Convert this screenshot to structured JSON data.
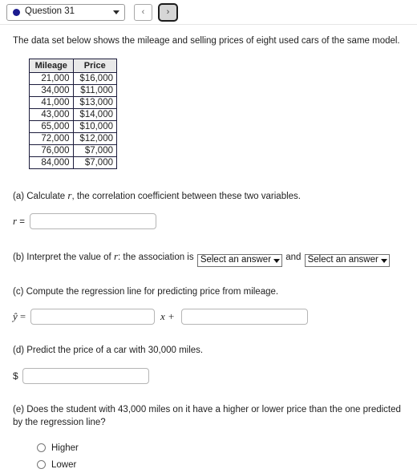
{
  "topbar": {
    "question_label": "Question 31",
    "dot_color": "#1b1b8f",
    "prev_label": "‹",
    "next_label": "›"
  },
  "intro": "The data set below shows the mileage and selling prices of eight used cars of the same model.",
  "table": {
    "headers": [
      "Mileage",
      "Price"
    ],
    "rows": [
      [
        "21,000",
        "$16,000"
      ],
      [
        "34,000",
        "$11,000"
      ],
      [
        "41,000",
        "$13,000"
      ],
      [
        "43,000",
        "$14,000"
      ],
      [
        "65,000",
        "$10,000"
      ],
      [
        "72,000",
        "$12,000"
      ],
      [
        "76,000",
        "$7,000"
      ],
      [
        "84,000",
        "$7,000"
      ]
    ]
  },
  "parts": {
    "a": {
      "prompt_before": "(a) Calculate ",
      "symbol": "r",
      "prompt_after": ", the correlation coefficient between these two variables.",
      "input_prefix_symbol": "r",
      "input_prefix_equals": " =",
      "input_value": "",
      "input_placeholder": ""
    },
    "b": {
      "prompt_before": "(b) Interpret the value of ",
      "symbol": "r",
      "prompt_middle": ": the association is ",
      "conjunction": " and ",
      "select_1_value": "Select an answer",
      "select_2_value": "Select an answer"
    },
    "c": {
      "prompt": "(c) Compute the regression line for predicting price from mileage.",
      "yhat_symbol": "ŷ",
      "equals": "=",
      "middle": "x +",
      "slope_value": "",
      "intercept_value": ""
    },
    "d": {
      "prompt": "(d) Predict the price of a car with 30,000 miles.",
      "dollar_prefix": "$",
      "input_value": ""
    },
    "e": {
      "prompt": "(e) Does the student with 43,000 miles on it have a higher or lower price than the one predicted by the regression line?",
      "options": [
        "Higher",
        "Lower"
      ]
    }
  }
}
